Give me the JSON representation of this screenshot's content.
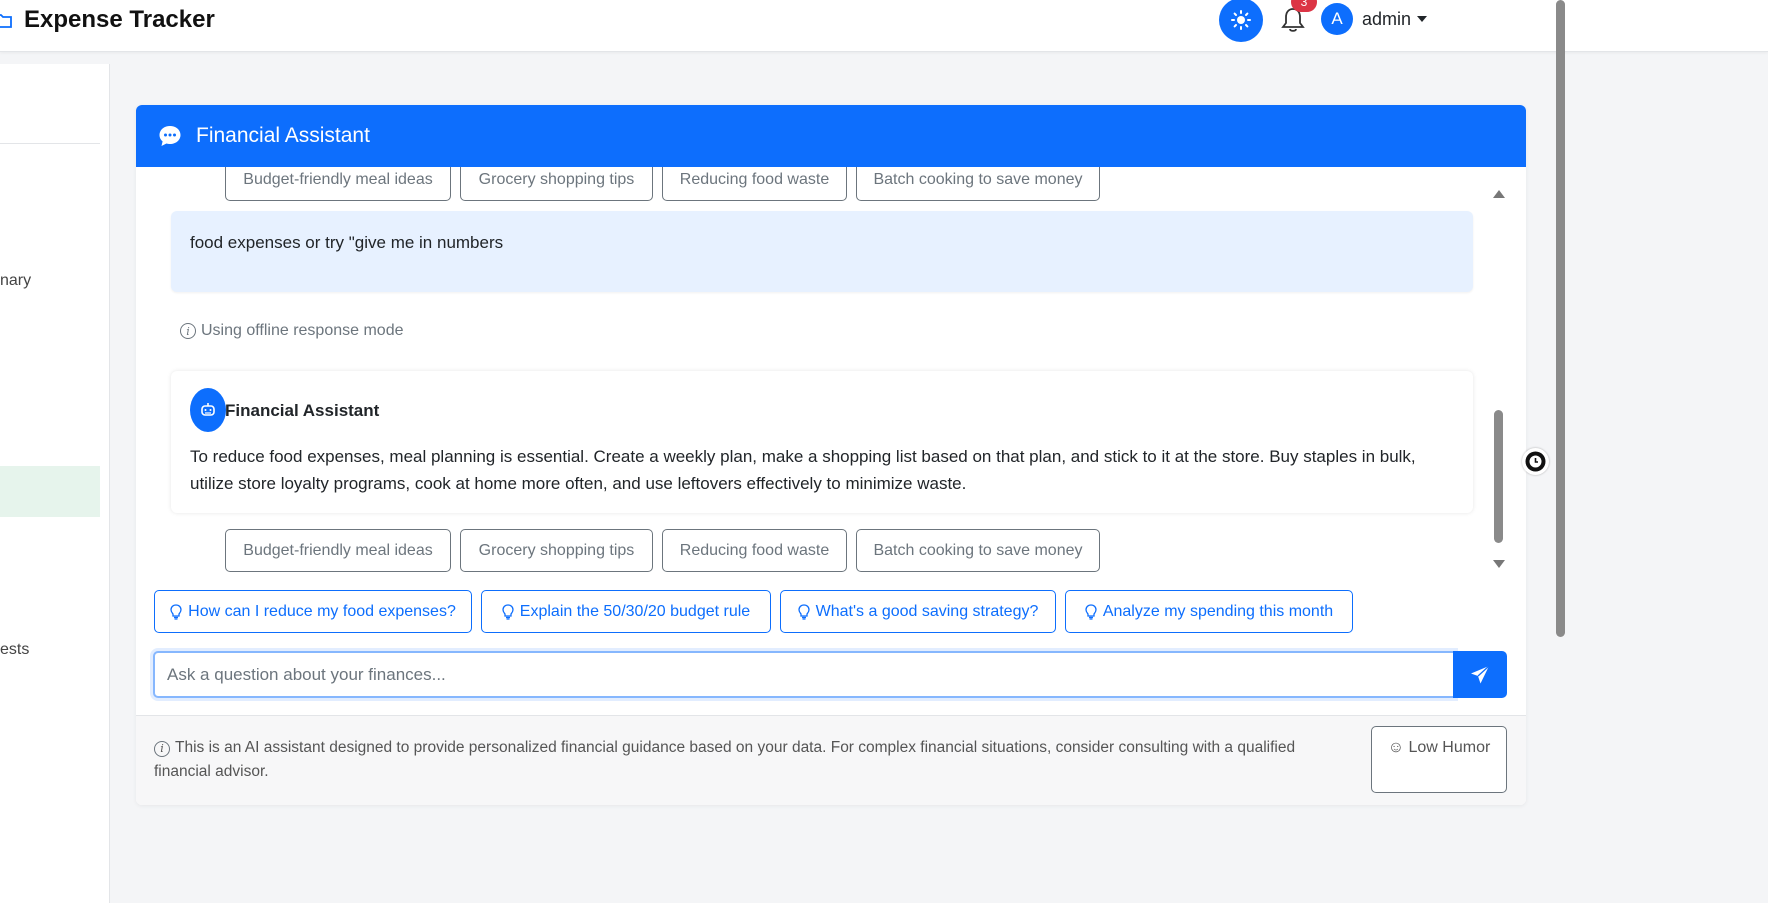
{
  "header": {
    "app_title": "Expense Tracker",
    "notification_count": "3",
    "user_initial": "A",
    "username": "admin"
  },
  "sidebar": {
    "items": [
      {
        "label": "nary"
      },
      {
        "label": "ests"
      }
    ]
  },
  "assistant": {
    "title": "Financial Assistant",
    "top_chips": [
      "Budget-friendly meal ideas",
      "Grocery shopping tips",
      "Reducing food waste",
      "Batch cooking to save money"
    ],
    "user_message": "food expenses or try \"give me in numbers",
    "offline_notice": "Using offline response mode",
    "bot_name": "Financial Assistant",
    "bot_message": "To reduce food expenses, meal planning is essential. Create a weekly plan, make a shopping list based on that plan, and stick to it at the store. Buy staples in bulk, utilize store loyalty programs, cook at home more often, and use leftovers effectively to minimize waste.",
    "follow_up_chips": [
      "Budget-friendly meal ideas",
      "Grocery shopping tips",
      "Reducing food waste",
      "Batch cooking to save money"
    ],
    "suggestions": [
      "How can I reduce my food expenses?",
      "Explain the 50/30/20 budget rule",
      "What's a good saving strategy?",
      "Analyze my spending this month"
    ],
    "input_placeholder": "Ask a question about your finances...",
    "disclaimer": "This is an AI assistant designed to provide personalized financial guidance based on your data. For complex financial situations, consider consulting with a qualified financial advisor.",
    "humor_label": "Low Humor"
  },
  "colors": {
    "primary": "#0d6efd",
    "user_bubble": "#e7f1ff",
    "badge": "#dc3545",
    "sidebar_active": "#e6f4ec"
  }
}
